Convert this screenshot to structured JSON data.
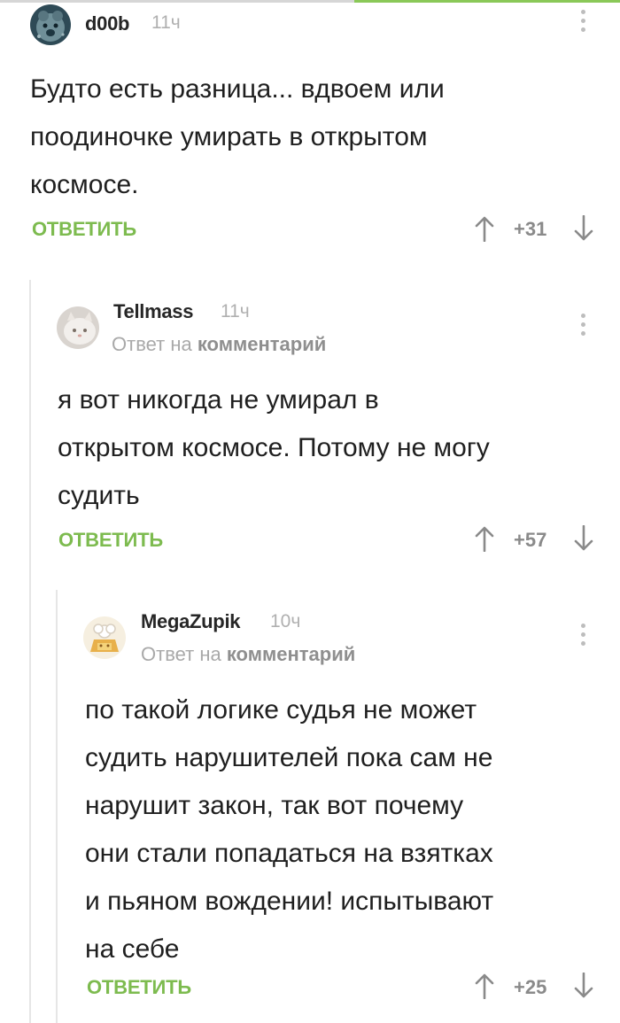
{
  "comments": [
    {
      "author": "d00b",
      "time": "11ч",
      "reply_prefix": "",
      "reply_target": "",
      "text": "Будто есть разница... вдвоем или\nпоодиночке умирать в открытом\nкосмосе.",
      "reply_label": "ОТВЕТИТЬ",
      "rating": "+31"
    },
    {
      "author": "Tellmass",
      "time": "11ч",
      "reply_prefix": "Ответ на ",
      "reply_target": "комментарий",
      "text": "я вот никогда не умирал в\nоткрытом космосе. Потому не могу\nсудить",
      "reply_label": "ОТВЕТИТЬ",
      "rating": "+57"
    },
    {
      "author": "MegaZupik",
      "time": "10ч",
      "reply_prefix": "Ответ на ",
      "reply_target": "комментарий",
      "text": "по такой логике судья не может\nсудить нарушителей пока сам не\nнарушит закон, так вот почему\nони стали попадаться на взятках\nи пьяном вождении! испытывают\nна себе",
      "reply_label": "ОТВЕТИТЬ",
      "rating": "+25"
    }
  ],
  "icons": {
    "more": "more-vertical-icon",
    "up": "arrow-up-icon",
    "down": "arrow-down-icon"
  },
  "colors": {
    "accent": "#7dbb4f",
    "meta": "#b0b0b0",
    "thread_line": "#e6e6e6"
  }
}
